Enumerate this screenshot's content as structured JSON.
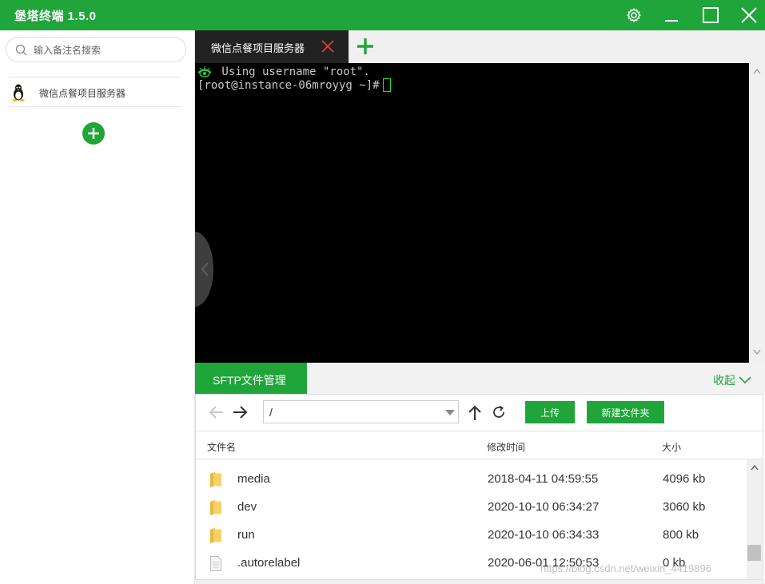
{
  "window": {
    "title": "堡塔终端 1.5.0"
  },
  "colors": {
    "brand_green": "#20a53a",
    "terminal_bg": "#000000",
    "tab_active_bg": "#222222",
    "tab_close": "#e0403a"
  },
  "icons": {
    "settings": "gear-icon",
    "minimize": "minimize-icon",
    "maximize": "maximize-icon",
    "close": "close-icon",
    "search": "search-icon",
    "os": "linux-icon",
    "add": "plus-icon"
  },
  "sidebar": {
    "search_placeholder": "输入备注名搜索",
    "servers": [
      {
        "label": "微信点餐项目服务器"
      }
    ]
  },
  "tabs": [
    {
      "label": "微信点餐项目服务器",
      "active": true
    }
  ],
  "terminal": {
    "lines": [
      " Using username \"root\".",
      "[root@instance-06mroyyg ~]#"
    ]
  },
  "sftp": {
    "tab_label": "SFTP文件管理",
    "collapse_label": "收起",
    "path": "/",
    "upload_label": "上传",
    "new_folder_label": "新建文件夹",
    "columns": {
      "name": "文件名",
      "modified": "修改时间",
      "size": "大小"
    },
    "files": [
      {
        "name": "media",
        "modified": "2018-04-11 04:59:55",
        "size": "4096 kb",
        "kind": "folder"
      },
      {
        "name": "dev",
        "modified": "2020-10-10 06:34:27",
        "size": "3060 kb",
        "kind": "folder"
      },
      {
        "name": "run",
        "modified": "2020-10-10 06:34:33",
        "size": "800 kb",
        "kind": "folder"
      },
      {
        "name": ".autorelabel",
        "modified": "2020-06-01 12:50:53",
        "size": "0 kb",
        "kind": "file"
      }
    ]
  },
  "watermark": "https://blog.csdn.net/weixin_4419896"
}
